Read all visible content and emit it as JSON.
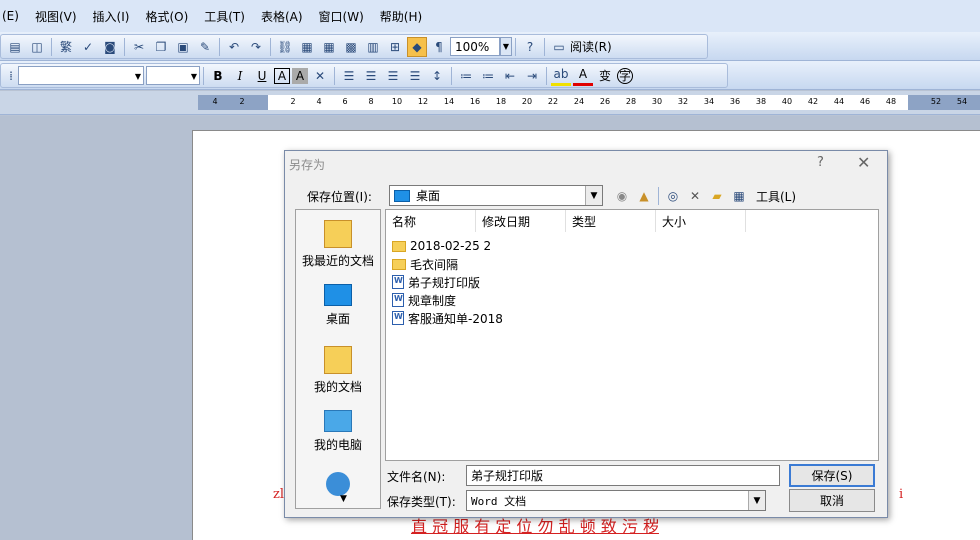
{
  "menu": [
    "(E)",
    "视图(V)",
    "插入(I)",
    "格式(O)",
    "工具(T)",
    "表格(A)",
    "窗口(W)",
    "帮助(H)"
  ],
  "toolbar": {
    "zoom": "100%",
    "read_label": "阅读(R)",
    "traditional": "繁",
    "bold": "B",
    "italic": "I",
    "underline": "U",
    "char_border": "A",
    "char_shade": "A",
    "font_color": "A",
    "phonetic": "变"
  },
  "ruler": {
    "ticks": [
      "4",
      "2",
      "2",
      "4",
      "6",
      "8",
      "10",
      "12",
      "14",
      "16",
      "18",
      "20",
      "22",
      "24",
      "26",
      "28",
      "30",
      "32",
      "34",
      "36",
      "38",
      "40",
      "42",
      "44",
      "46",
      "48",
      "52",
      "54"
    ]
  },
  "document": {
    "line1": "直 冠 服   有 定 位   勿 乱 顿   致 污 秽",
    "frag_z": "zl",
    "frag_i": "i"
  },
  "dialog": {
    "title": "另存为",
    "help": "?",
    "close": "✕",
    "location_label": "保存位置(I):",
    "location_value": "桌面",
    "tools_label": "工具(L)",
    "places": [
      {
        "label": "我最近的文档"
      },
      {
        "label": "桌面"
      },
      {
        "label": "我的文档"
      },
      {
        "label": "我的电脑"
      }
    ],
    "columns": [
      "名称",
      "修改日期",
      "类型",
      "大小"
    ],
    "files": [
      {
        "name": "2018-02-25 2",
        "type": "folder"
      },
      {
        "name": "毛衣间隔",
        "type": "folder"
      },
      {
        "name": "弟子规打印版",
        "type": "doc"
      },
      {
        "name": "规章制度",
        "type": "doc"
      },
      {
        "name": "客服通知单-2018",
        "type": "doc"
      }
    ],
    "filename_label": "文件名(N):",
    "filename_value": "弟子规打印版",
    "filetype_label": "保存类型(T):",
    "filetype_value": "Word 文档",
    "save_button": "保存(S)",
    "cancel_button": "取消"
  }
}
